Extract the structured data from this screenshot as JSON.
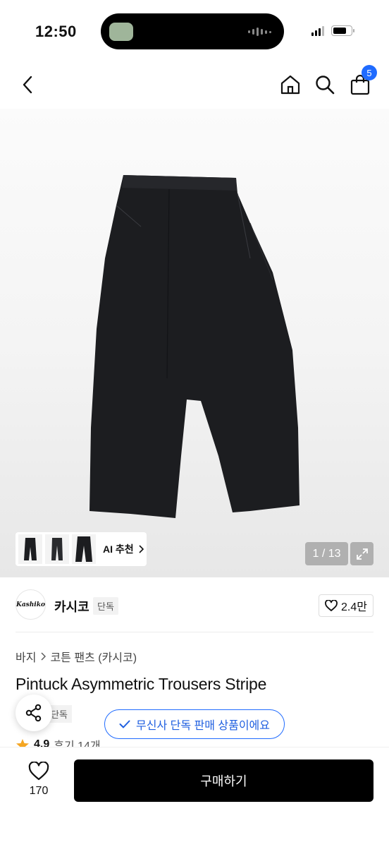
{
  "status_bar": {
    "time": "12:50"
  },
  "nav": {
    "cart_count": "5"
  },
  "gallery": {
    "ai_label": "AI 추천",
    "counter": "1 / 13"
  },
  "brand": {
    "logo_text": "Kashiko",
    "name": "카시코",
    "tag": "단독",
    "likes": "2.4만"
  },
  "product": {
    "breadcrumb": [
      "바지",
      "코튼 팬츠 (카시코)"
    ],
    "title": "Pintuck Asymmetric Trousers Stripe",
    "exclusive_tag": "단독",
    "rating": "4.9",
    "reviews": "후기 14개"
  },
  "toast": {
    "text": "무신사 단독 판매 상품이에요"
  },
  "bottom_bar": {
    "wish_count": "170",
    "buy_label": "구매하기"
  },
  "colors": {
    "accent": "#1f6bff",
    "buy_button": "#000000",
    "star": "#f5a623"
  }
}
